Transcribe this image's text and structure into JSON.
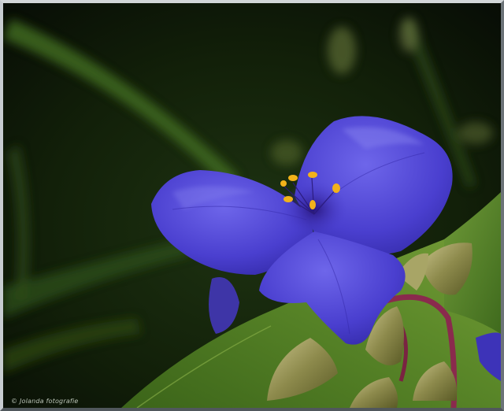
{
  "watermark": {
    "text": "© Jolanda fotografie"
  },
  "colors": {
    "background": "#0b1208",
    "petal": "#4a3fcf",
    "petal_highlight": "#6f69e8",
    "petal_shadow": "#2f26a0",
    "anther": "#f2b21a",
    "leaf": "#4f7a23",
    "stem": "#8a2a4d"
  }
}
